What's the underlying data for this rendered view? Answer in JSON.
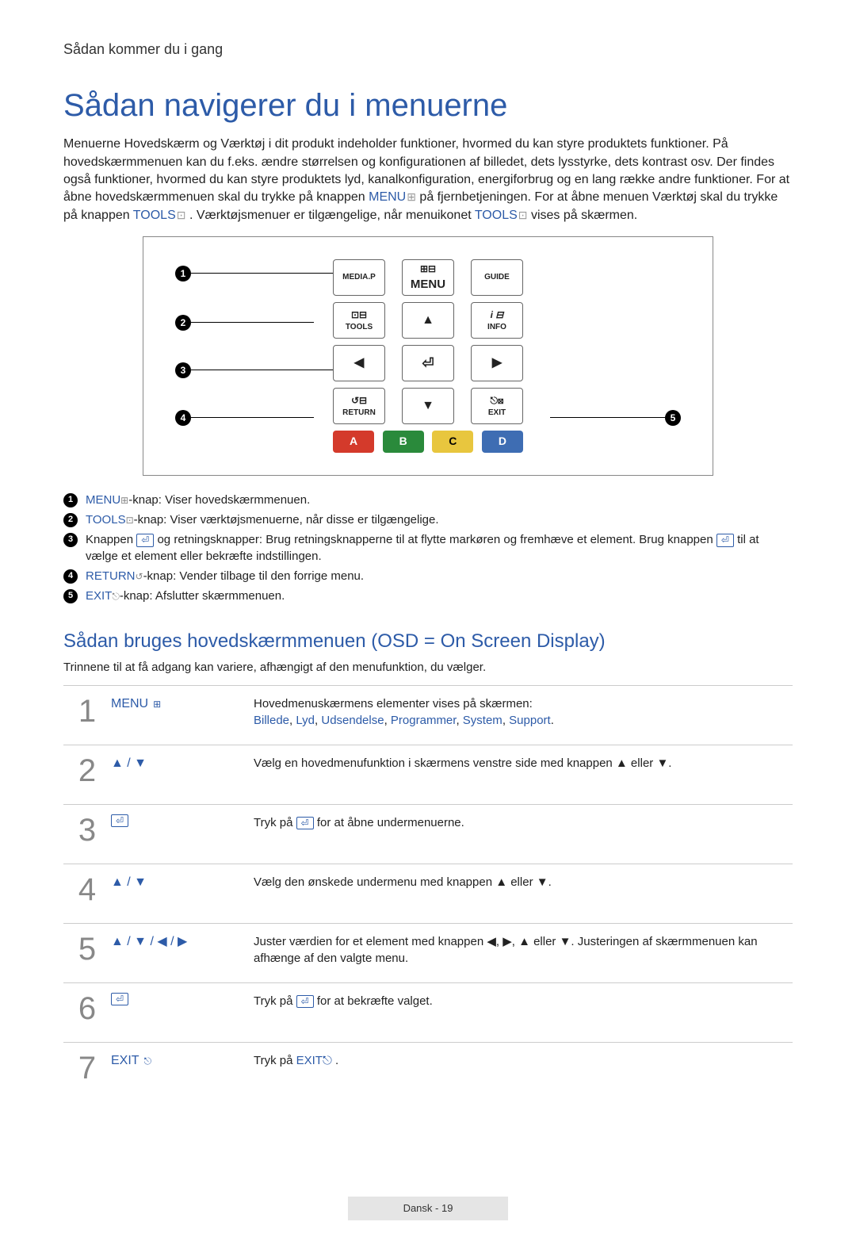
{
  "breadcrumb": "Sådan kommer du i gang",
  "title": "Sådan navigerer du i menuerne",
  "intro": {
    "p1": "Menuerne Hovedskærm og Værktøj i dit produkt indeholder funktioner, hvormed du kan styre produktets funktioner. På hovedskærmmenuen kan du f.eks. ændre størrelsen og konfigurationen af billedet, dets lysstyrke, dets kontrast osv. Der findes også funktioner, hvormed du kan styre produktets lyd, kanalkonfiguration, energiforbrug og en lang række andre funktioner. For at åbne hovedskærmmenuen skal du trykke på knappen ",
    "menu_kw": "MENU",
    "p2": " på fjernbetjeningen. For at åbne menuen Værktøj skal du trykke på knappen ",
    "tools_kw": "TOOLS",
    "p3": ". Værktøjsmenuer er tilgængelige, når menuikonet ",
    "tools_kw2": "TOOLS",
    "p4": " vises på skærmen."
  },
  "remote_buttons": {
    "mediap": "MEDIA.P",
    "menu": "MENU",
    "guide": "GUIDE",
    "tools": "TOOLS",
    "info": "INFO",
    "return": "RETURN",
    "exit": "EXIT",
    "colorA": "A",
    "colorB": "B",
    "colorC": "C",
    "colorD": "D"
  },
  "callouts": [
    "1",
    "2",
    "3",
    "4",
    "5"
  ],
  "legend": [
    {
      "num": "1",
      "kw": "MENU",
      "icon": "⊞",
      "text": "-knap: Viser hovedskærmmenuen."
    },
    {
      "num": "2",
      "kw": "TOOLS",
      "icon": "⊡",
      "text": "-knap: Viser værktøjsmenuerne, når disse er tilgængelige."
    },
    {
      "num": "3",
      "kw": "",
      "icon": "",
      "text_pre": "Knappen ",
      "enter": "⏎",
      "text_mid": " og retningsknapper: Brug retningsknapperne til at flytte markøren og fremhæve et element. Brug knappen ",
      "enter2": "⏎",
      "text_post": " til at vælge et element eller bekræfte indstillingen."
    },
    {
      "num": "4",
      "kw": "RETURN",
      "icon": "↺",
      "text": "-knap: Vender tilbage til den forrige menu."
    },
    {
      "num": "5",
      "kw": "EXIT",
      "icon": "⎋",
      "text": "-knap: Afslutter skærmmenuen."
    }
  ],
  "subtitle": "Sådan bruges hovedskærmmenuen (OSD = On Screen Display)",
  "sub_intro": "Trinnene til at få adgang kan variere, afhængigt af den menufunktion, du vælger.",
  "steps": [
    {
      "num": "1",
      "button_label": "MENU",
      "button_icon": "⊞",
      "desc_pre": "Hovedmenuskærmens elementer vises på skærmen:",
      "links": [
        "Billede",
        "Lyd",
        "Udsendelse",
        "Programmer",
        "System",
        "Support"
      ],
      "desc_post": "."
    },
    {
      "num": "2",
      "button_label": "",
      "button_arrows": "▲ / ▼",
      "desc": "Vælg en hovedmenufunktion i skærmens venstre side med knappen ▲ eller ▼."
    },
    {
      "num": "3",
      "button_label": "",
      "button_enter": "⏎",
      "desc_pre": "Tryk på ",
      "enter": "⏎",
      "desc_post": " for at åbne undermenuerne."
    },
    {
      "num": "4",
      "button_label": "",
      "button_arrows": "▲ / ▼",
      "desc": "Vælg den ønskede undermenu med knappen ▲ eller ▼."
    },
    {
      "num": "5",
      "button_label": "",
      "button_arrows": "▲ / ▼ / ◀ / ▶",
      "desc": "Juster værdien for et element med knappen ◀, ▶, ▲ eller ▼. Justeringen af skærmmenuen kan afhænge af den valgte menu."
    },
    {
      "num": "6",
      "button_label": "",
      "button_enter": "⏎",
      "desc_pre": "Tryk på ",
      "enter": "⏎",
      "desc_post": " for at bekræfte valget."
    },
    {
      "num": "7",
      "button_label": "EXIT",
      "button_icon": "⎋",
      "desc_pre": "Tryk på ",
      "exit_kw": "EXIT",
      "desc_post": "."
    }
  ],
  "footer": "Dansk - 19"
}
